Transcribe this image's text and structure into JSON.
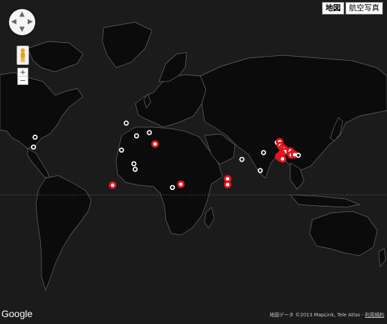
{
  "map_type": {
    "map_label": "地図",
    "satellite_label": "航空写真",
    "selected": "map"
  },
  "controls": {
    "pan_icon": "pan-arrows-icon",
    "pegman_icon": "pegman-icon",
    "zoom_in": "+",
    "zoom_out": "−"
  },
  "logo": "Google",
  "attribution": {
    "text": "地図データ ©2013 MapLink, Tele Atlas -",
    "terms": "利用規約"
  },
  "colors": {
    "ocean": "#1b1b1b",
    "land": "#0b0b0b",
    "border": "#6a6a6a",
    "marker_red": "#e1141e",
    "marker_white": "#ffffff",
    "equator": "#8a4a4a"
  },
  "markers": [
    {
      "lat": 45.4,
      "lng": -75.7,
      "color": "white"
    },
    {
      "lat": 38.9,
      "lng": -77.0,
      "color": "white"
    },
    {
      "lat": 53.5,
      "lng": -2.2,
      "color": "white"
    },
    {
      "lat": 46.2,
      "lng": 6.1,
      "color": "white"
    },
    {
      "lat": 48.2,
      "lng": 16.4,
      "color": "white"
    },
    {
      "lat": 41.0,
      "lng": 21.0,
      "color": "red"
    },
    {
      "lat": 36.8,
      "lng": -6.0,
      "color": "white"
    },
    {
      "lat": 26.5,
      "lng": 4.0,
      "color": "white"
    },
    {
      "lat": 22.0,
      "lng": 5.0,
      "color": "white"
    },
    {
      "lat": 8.5,
      "lng": -13.2,
      "color": "red"
    },
    {
      "lat": 9.3,
      "lng": 41.8,
      "color": "red"
    },
    {
      "lat": 6.5,
      "lng": 35.0,
      "color": "white"
    },
    {
      "lat": 14.0,
      "lng": 79.5,
      "color": "red"
    },
    {
      "lat": 9.0,
      "lng": 79.5,
      "color": "red"
    },
    {
      "lat": 29.9,
      "lng": 91.0,
      "color": "white"
    },
    {
      "lat": 35.0,
      "lng": 108.5,
      "color": "white"
    },
    {
      "lat": 21.0,
      "lng": 105.8,
      "color": "white"
    },
    {
      "lat": 42.0,
      "lng": 119.5,
      "color": "white"
    },
    {
      "lat": 42.5,
      "lng": 121.5,
      "color": "red"
    },
    {
      "lat": 40.0,
      "lng": 122.0,
      "color": "red"
    },
    {
      "lat": 38.5,
      "lng": 123.8,
      "color": "red"
    },
    {
      "lat": 37.5,
      "lng": 125.3,
      "color": "red"
    },
    {
      "lat": 35.8,
      "lng": 125.9,
      "color": "red"
    },
    {
      "lat": 34.3,
      "lng": 123.0,
      "color": "red"
    },
    {
      "lat": 33.0,
      "lng": 122.0,
      "color": "red"
    },
    {
      "lat": 32.2,
      "lng": 120.7,
      "color": "red"
    },
    {
      "lat": 31.5,
      "lng": 121.4,
      "color": "red"
    },
    {
      "lat": 30.8,
      "lng": 122.5,
      "color": "red"
    },
    {
      "lat": 30.3,
      "lng": 123.8,
      "color": "red"
    },
    {
      "lat": 36.2,
      "lng": 130.0,
      "color": "red"
    },
    {
      "lat": 34.3,
      "lng": 132.0,
      "color": "red"
    },
    {
      "lat": 33.3,
      "lng": 130.8,
      "color": "red"
    },
    {
      "lat": 33.5,
      "lng": 133.5,
      "color": "red"
    },
    {
      "lat": 33.0,
      "lng": 136.5,
      "color": "white"
    }
  ]
}
